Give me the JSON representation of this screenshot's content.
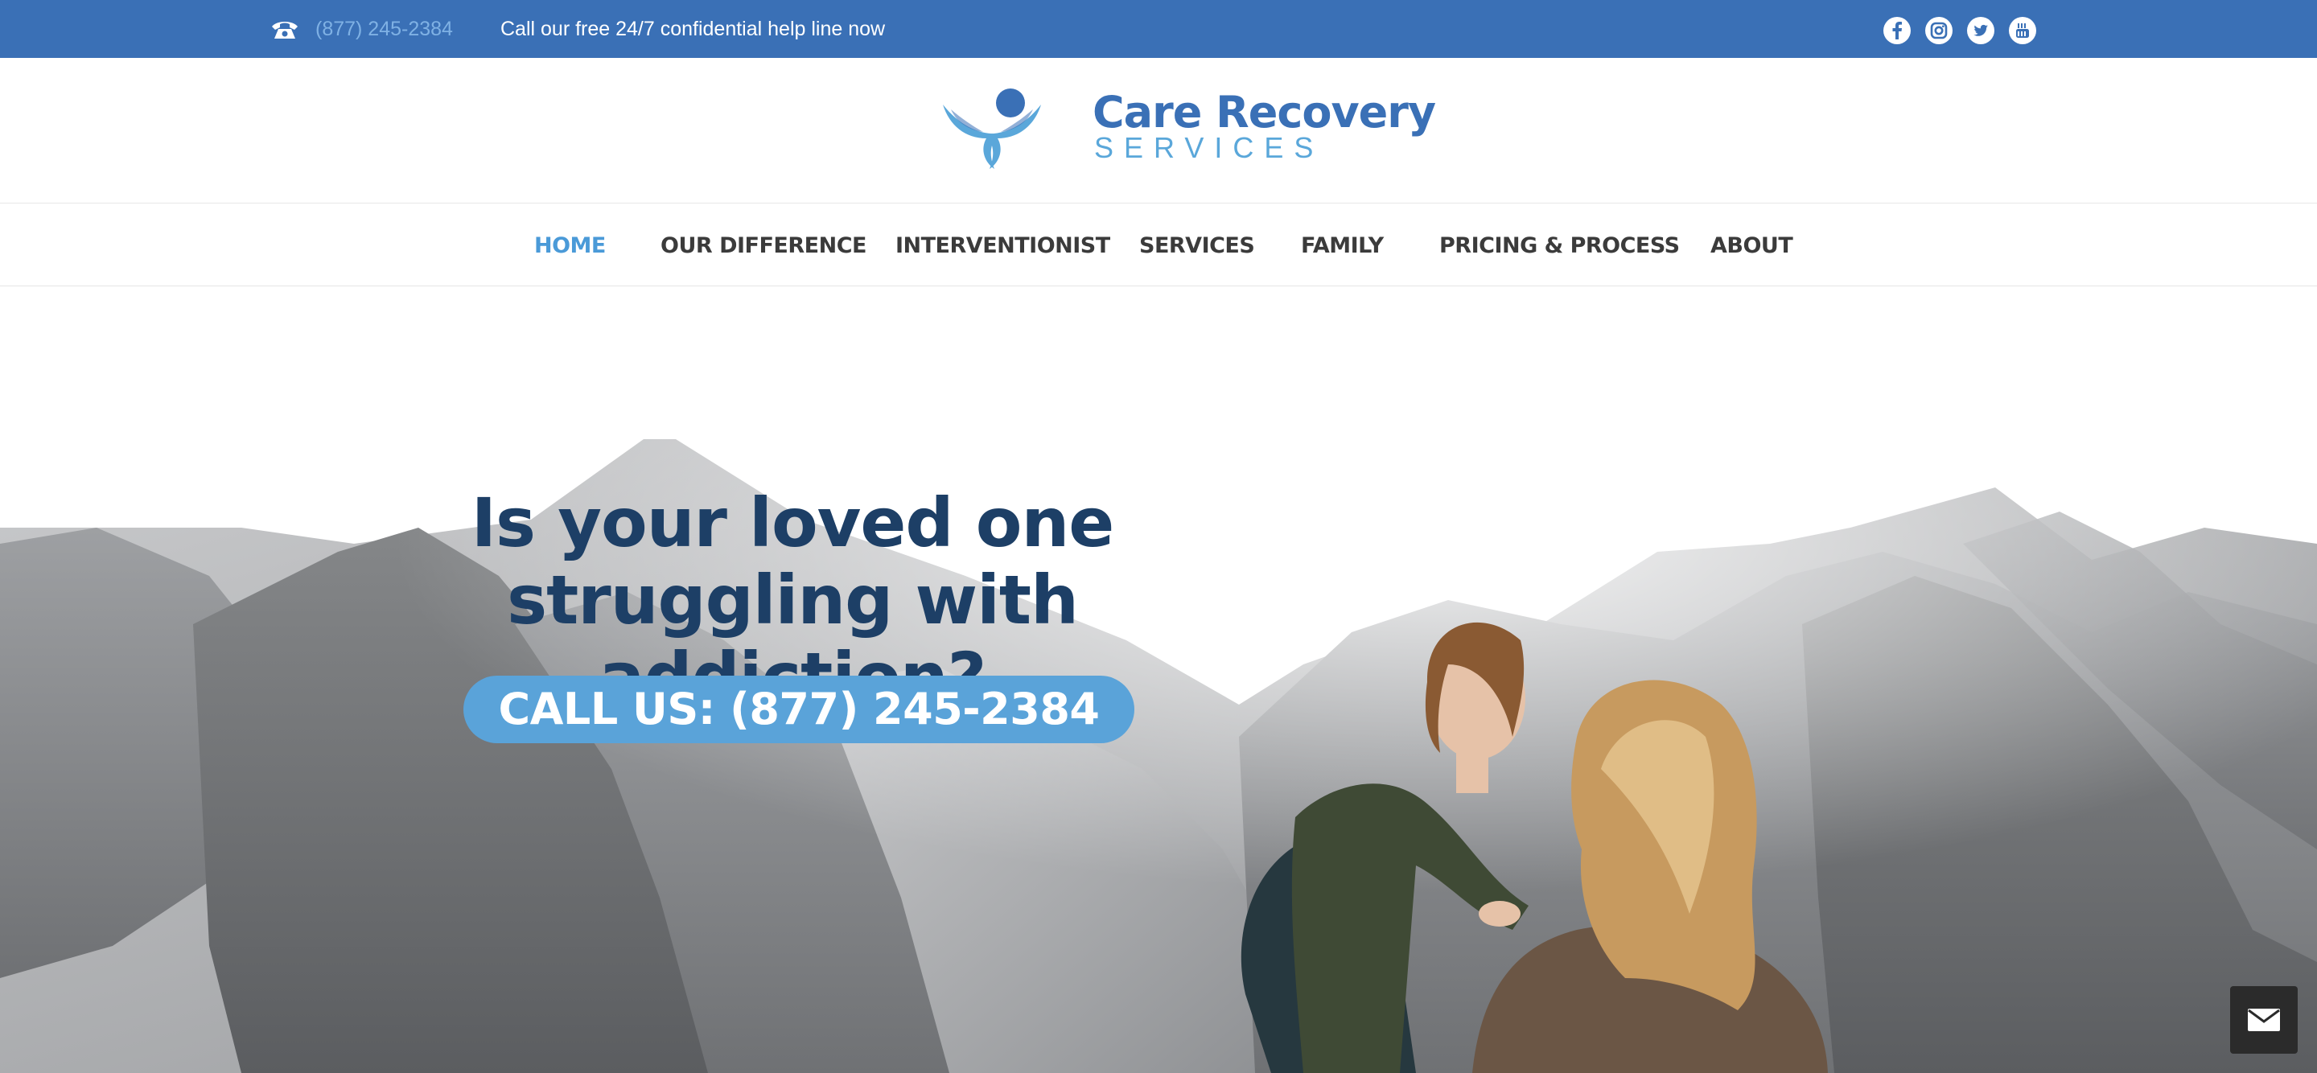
{
  "topbar": {
    "phone_icon": "telephone-icon",
    "phone": "(877) 245-2384",
    "tagline": "Call our free 24/7 confidential help line now",
    "socials": [
      "facebook-icon",
      "instagram-icon",
      "twitter-icon",
      "youtube-icon"
    ],
    "bg_color": "#3a70b6"
  },
  "logo": {
    "title": "Care Recovery",
    "subtitle": "SERVICES",
    "icon": "care-hands-icon"
  },
  "nav": {
    "items": [
      {
        "label": "HOME",
        "active": true
      },
      {
        "label": "OUR DIFFERENCE",
        "active": false
      },
      {
        "label": "INTERVENTIONIST",
        "active": false
      },
      {
        "label": "SERVICES",
        "active": false
      },
      {
        "label": "FAMILY",
        "active": false
      },
      {
        "label": "PRICING & PROCESS",
        "active": false
      },
      {
        "label": "ABOUT",
        "active": false
      }
    ],
    "active_color": "#4a9ad8"
  },
  "hero": {
    "headline_line1": "Is your loved one",
    "headline_line2": "struggling with addiction?",
    "cta_label": "CALL US: (877) 245-2384",
    "cta_color": "#5aa3d9",
    "headline_color": "#1d3f66"
  },
  "contact_widget": {
    "icon": "envelope-icon"
  }
}
